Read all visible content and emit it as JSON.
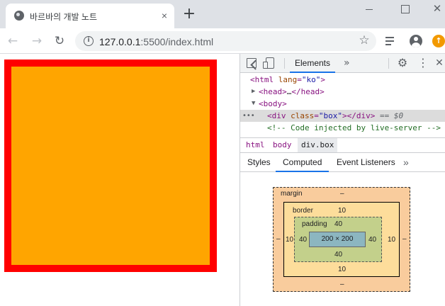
{
  "browser": {
    "tab_title": "바르바의 개발 노트",
    "tab_close": "×",
    "new_tab": "+",
    "window_close": "✕",
    "url_host": "127.0.0.1",
    "url_port_path": ":5500/index.html",
    "back": "←",
    "forward": "→",
    "reload": "↻",
    "info": "i",
    "bookmark": "☆",
    "update_badge": "↑"
  },
  "page": {
    "box_color": "#ffa500",
    "box_border_color": "#ff0000"
  },
  "devtools": {
    "panel_tab": "Elements",
    "more": "»",
    "gear": "⚙",
    "menu": "⋮",
    "close": "✕",
    "dom": {
      "html_open": "<html ",
      "html_lang_attr": "lang",
      "html_lang_val": "\"ko\"",
      "html_close": ">",
      "head": "<head>",
      "head_ellipsis": "…",
      "head_end": "</head>",
      "body": "<body>",
      "dots": "•••",
      "div_open": "<div ",
      "div_class_attr": "class",
      "div_class_val": "\"box\"",
      "div_close": "></div>",
      "div_marker": " == $0",
      "comment": "<!-- Code injected by live-server -->"
    },
    "breadcrumbs": [
      "html",
      "body",
      "div.box"
    ],
    "sub_tabs": [
      "Styles",
      "Computed",
      "Event Listeners"
    ],
    "active_sub_tab": "Computed",
    "box_model": {
      "margin_label": "margin",
      "margin_top": "–",
      "margin_bottom": "–",
      "margin_left": "–",
      "margin_right": "–",
      "border_label": "border",
      "border_top": "10",
      "border_bottom": "10",
      "border_left": "10",
      "border_right": "10",
      "padding_label": "padding",
      "padding_top": "40",
      "padding_bottom": "40",
      "padding_left": "40",
      "padding_right": "40",
      "content": "200 × 200"
    }
  }
}
